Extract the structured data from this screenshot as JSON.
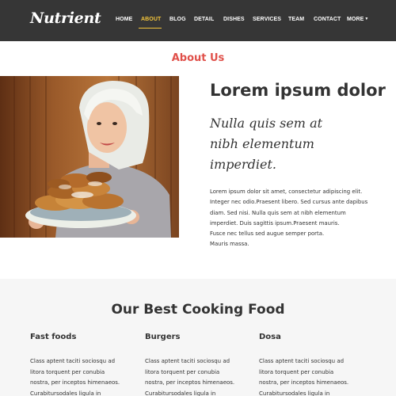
{
  "brand": {
    "logo_text": "Nutrient"
  },
  "nav": {
    "items": [
      {
        "label": "HOME"
      },
      {
        "label": "ABOUT"
      },
      {
        "label": "BLOG"
      },
      {
        "label": "DETAIL"
      },
      {
        "label": "DISHES"
      },
      {
        "label": "SERVICES"
      },
      {
        "label": "TEAM"
      },
      {
        "label": "CONTACT"
      },
      {
        "label": "MORE"
      }
    ],
    "active_color": "#f4c53b"
  },
  "about": {
    "heading": "About Us",
    "title": "Lorem ipsum dolor",
    "script_lines": [
      "Nulla quis sem at",
      "nibh elementum",
      "imperdiet."
    ],
    "body_lines": [
      "Lorem ipsum dolor sit amet, consectetur adipiscing elit.",
      "Integer nec odio.Praesent libero. Sed cursus ante dapibus",
      "diam. Sed nisi. Nulla quis sem at nibh elementum",
      "imperdiet. Duis sagittis ipsum.Praesent mauris.",
      "Fusce nec tellus sed augue semper porta.",
      "Mauris massa."
    ],
    "heading_color": "#e0504a"
  },
  "best": {
    "title": "Our Best Cooking Food",
    "columns": [
      {
        "title": "Fast foods",
        "lines": [
          "Class aptent taciti sociosqu ad",
          "litora torquent per conubia",
          "nostra, per inceptos himenaeos.",
          "Curabitursodales ligula in"
        ]
      },
      {
        "title": "Burgers",
        "lines": [
          "Class aptent taciti sociosqu ad",
          "litora torquent per conubia",
          "nostra, per inceptos himenaeos.",
          "Curabitursodales ligula in"
        ]
      },
      {
        "title": "Dosa",
        "lines": [
          "Class aptent taciti sociosqu ad",
          "litora torquent per conubia",
          "nostra, per inceptos himenaeos.",
          "Curabitursodales ligula in"
        ]
      }
    ]
  }
}
